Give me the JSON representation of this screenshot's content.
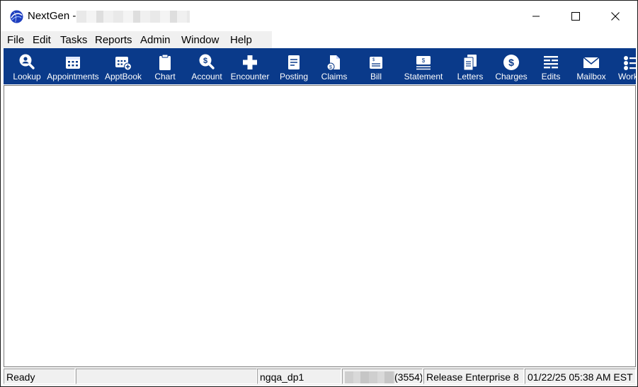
{
  "window": {
    "app_name": "NextGen -",
    "controls": {
      "minimize": "minimize",
      "maximize": "maximize",
      "close": "close"
    }
  },
  "menu": [
    "File",
    "Edit",
    "Tasks",
    "Reports",
    "Admin",
    "Window",
    "Help"
  ],
  "toolbar": [
    {
      "label": "Lookup",
      "icon": "lookup-icon"
    },
    {
      "label": "Appointments",
      "icon": "appointments-icon"
    },
    {
      "label": "ApptBook",
      "icon": "apptbook-icon"
    },
    {
      "label": "Chart",
      "icon": "chart-icon"
    },
    {
      "label": "Account",
      "icon": "account-icon"
    },
    {
      "label": "Encounter",
      "icon": "encounter-icon"
    },
    {
      "label": "Posting",
      "icon": "posting-icon"
    },
    {
      "label": "Claims",
      "icon": "claims-icon"
    },
    {
      "label": "Bill",
      "icon": "bill-icon"
    },
    {
      "label": "Statement",
      "icon": "statement-icon"
    },
    {
      "label": "Letters",
      "icon": "letters-icon"
    },
    {
      "label": "Charges",
      "icon": "charges-icon"
    },
    {
      "label": "Edits",
      "icon": "edits-icon"
    },
    {
      "label": "Mailbox",
      "icon": "mailbox-icon"
    },
    {
      "label": "Work",
      "icon": "work-icon"
    }
  ],
  "status": {
    "ready": "Ready",
    "user": "ngqa_dp1",
    "count": "(3554)",
    "release": "Release Enterprise 8",
    "datetime": "01/22/25  05:38 AM EST"
  },
  "colors": {
    "toolbar_bg": "#0a3a8a",
    "menu_bg": "#f0f0f0",
    "status_bg": "#f0f0f0"
  }
}
